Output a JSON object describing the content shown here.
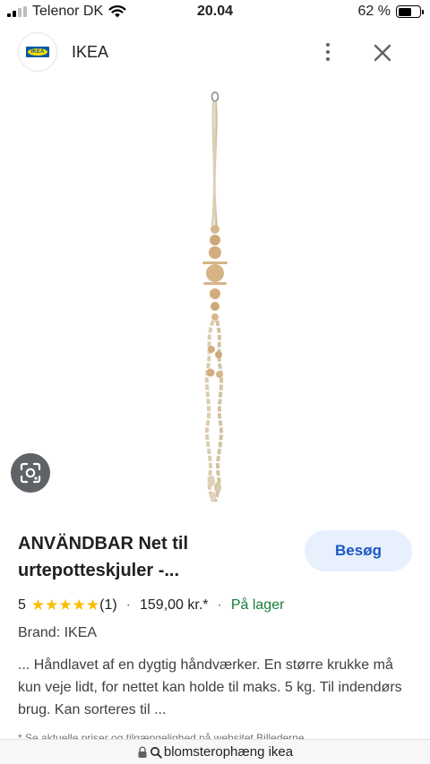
{
  "status_bar": {
    "carrier": "Telenor DK",
    "time": "20.04",
    "battery_percent": "62 %",
    "battery_level": 0.62
  },
  "header": {
    "logo_text": "IKEA",
    "title": "IKEA"
  },
  "product": {
    "title": "ANVÄNDBAR Net til urtepotteskjuler -...",
    "visit_label": "Besøg",
    "rating_value": "5",
    "stars": "★★★★★",
    "review_count": "(1)",
    "separator": "·",
    "price": "159,00 kr.*",
    "stock": "På lager",
    "brand": "Brand: IKEA",
    "description": "... Håndlavet af en dygtig håndværker. En større krukke må kun veje lidt, for nettet kan holde til maks. 5 kg. Til indendørs brug. Kan sorteres til ...",
    "disclaimer": "* Se aktuelle priser og tilgængelighed på websitet Billederne"
  },
  "url_bar": {
    "query": "blomsterophæng ikea"
  },
  "colors": {
    "visit_bg": "#e8f0fe",
    "visit_text": "#1a56c4",
    "stock_green": "#188038",
    "star_yellow": "#fbbc04"
  },
  "icons": [
    "wifi-icon",
    "more-vert-icon",
    "close-icon",
    "lens-icon",
    "lock-icon",
    "search-icon"
  ]
}
